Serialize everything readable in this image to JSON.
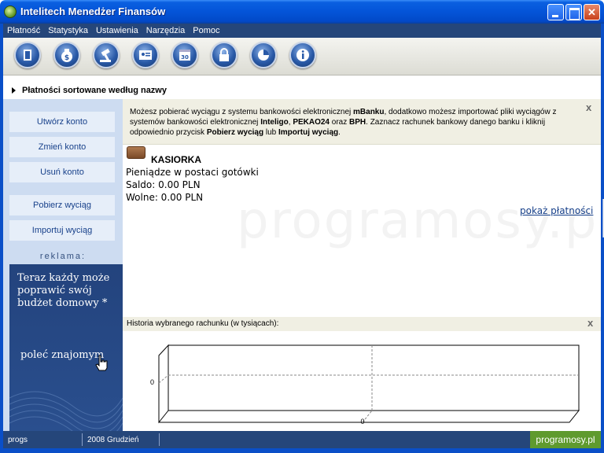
{
  "window": {
    "title": "Intelitech Menedżer Finansów",
    "min_label": "",
    "max_label": "",
    "close_label": "✕"
  },
  "menu": {
    "items": [
      "Płatność",
      "Statystyka",
      "Ustawienia",
      "Narzędzia",
      "Pomoc"
    ]
  },
  "toolbar": {
    "buttons": [
      {
        "icon": "book-icon",
        "glyph": "▮"
      },
      {
        "icon": "money-bag-icon",
        "glyph": "$"
      },
      {
        "icon": "gavel-icon",
        "glyph": "⚒"
      },
      {
        "icon": "contacts-card-icon",
        "glyph": "▤"
      },
      {
        "icon": "calendar-icon",
        "glyph": "30"
      },
      {
        "icon": "padlock-icon",
        "glyph": "🔒"
      },
      {
        "icon": "pie-chart-icon",
        "glyph": "◔"
      },
      {
        "icon": "info-icon",
        "glyph": "i"
      }
    ]
  },
  "section": {
    "title": "Płatności sortowane według nazwy"
  },
  "sidebar": {
    "buttons": [
      {
        "label": "Utwórz konto"
      },
      {
        "label": "Zmień konto"
      },
      {
        "label": "Usuń konto"
      },
      {
        "label": "Pobierz wyciąg"
      },
      {
        "label": "Importuj wyciąg"
      }
    ],
    "ad_label": "reklama:",
    "ad_text": "Teraz każdy może poprawić swój budżet domowy *",
    "ad_link": "poleć znajomym"
  },
  "info": {
    "p1": "Możesz pobierać wyciągu z systemu bankowości elektronicznej ",
    "b1": "mBanku",
    "p2": ", dodatkowo możesz importować pliki wyciągów z systemów bankowości elektronicznej ",
    "b2": "Inteligo",
    "p3": ", ",
    "b3": "PEKAO24",
    "p4": " oraz ",
    "b4": "BPH",
    "p5": ". Zaznacz rachunek bankowy danego banku i kliknij odpowiednio przycisk ",
    "b5": "Pobierz wyciąg",
    "p6": " lub ",
    "b6": "Importuj wyciąg",
    "p7": "."
  },
  "account": {
    "name": "KASIORKA",
    "description": "Pieniądze w postaci gotówki",
    "saldo": "Saldo: 0.00 PLN",
    "wolne": "Wolne: 0.00 PLN",
    "show_payments": "pokaż płatności"
  },
  "watermark": "programosy.pl",
  "history": {
    "title": "Historia wybranego rachunku (w tysiącach):"
  },
  "chart_data": {
    "type": "bar",
    "categories": [
      "0"
    ],
    "values": [
      0
    ],
    "title": "Historia wybranego rachunku (w tysiącach):",
    "xlabel": "",
    "ylabel": "",
    "y_ticks": [
      "0"
    ],
    "x_ticks": [
      "0"
    ],
    "grid": true
  },
  "status": {
    "user": "progs",
    "month": "2008 Grudzień",
    "brand": "programosy.pl"
  },
  "colors": {
    "titlebar": "#0454d8",
    "menubar": "#25467a",
    "sidebar": "#cddcf1",
    "info_bg": "#f0efe3",
    "link": "#17408a",
    "brand": "#5f9a2e"
  }
}
